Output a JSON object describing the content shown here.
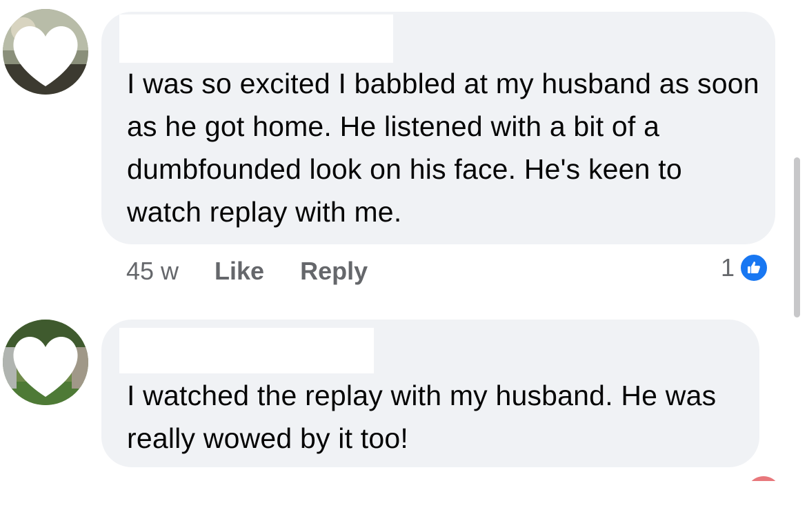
{
  "comments": [
    {
      "text": "I was so excited I babbled at my husband as soon as he got home. He listened with a bit of a dumbfounded look on his face. He's keen to watch replay with me.",
      "time": "45 w",
      "like_label": "Like",
      "reply_label": "Reply",
      "reaction_count": "1",
      "reaction_icon": "thumbs-up-icon"
    },
    {
      "text": "I watched the replay with my husband. He was really wowed by it too!"
    }
  ],
  "colors": {
    "bubble": "#f0f2f5",
    "meta_text": "#65676b",
    "like_blue": "#1877f2"
  }
}
